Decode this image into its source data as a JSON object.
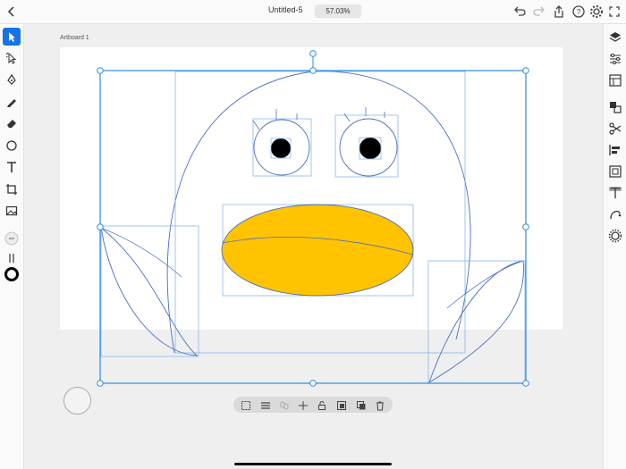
{
  "app": {
    "document_title": "Untitled-5",
    "zoom_level": "57.03%",
    "artboard_label": "Artboard 1"
  },
  "topbar": {
    "icons": [
      "chevron-left-icon",
      "undo-icon",
      "redo-icon",
      "share-icon",
      "help-icon",
      "gear-icon",
      "fullscreen-icon"
    ]
  },
  "left_toolbar": {
    "tools": [
      "select-icon",
      "direct-select-icon",
      "pen-icon",
      "pencil-icon",
      "eraser-icon",
      "shape-icon",
      "text-icon",
      "crop-icon",
      "image-icon",
      "more-icon",
      "swap-icon",
      "stroke-icon"
    ],
    "active_tool": "select-icon"
  },
  "right_toolbar": {
    "tools": [
      "layers-icon",
      "properties-icon",
      "libraries-icon",
      "arrange-icon",
      "scissors-icon",
      "align-icon",
      "transform-icon",
      "type-icon",
      "path-icon",
      "effects-icon"
    ]
  },
  "context_bar": {
    "icons": [
      "select-all-icon",
      "menu-icon",
      "link-icon",
      "move-icon",
      "lock-icon",
      "mask-icon",
      "duplicate-icon",
      "delete-icon"
    ]
  },
  "colors": {
    "accent": "#1473e6",
    "beak_fill": "#ffc300",
    "selection": "#2c8be8",
    "eye_fill": "#000000"
  }
}
